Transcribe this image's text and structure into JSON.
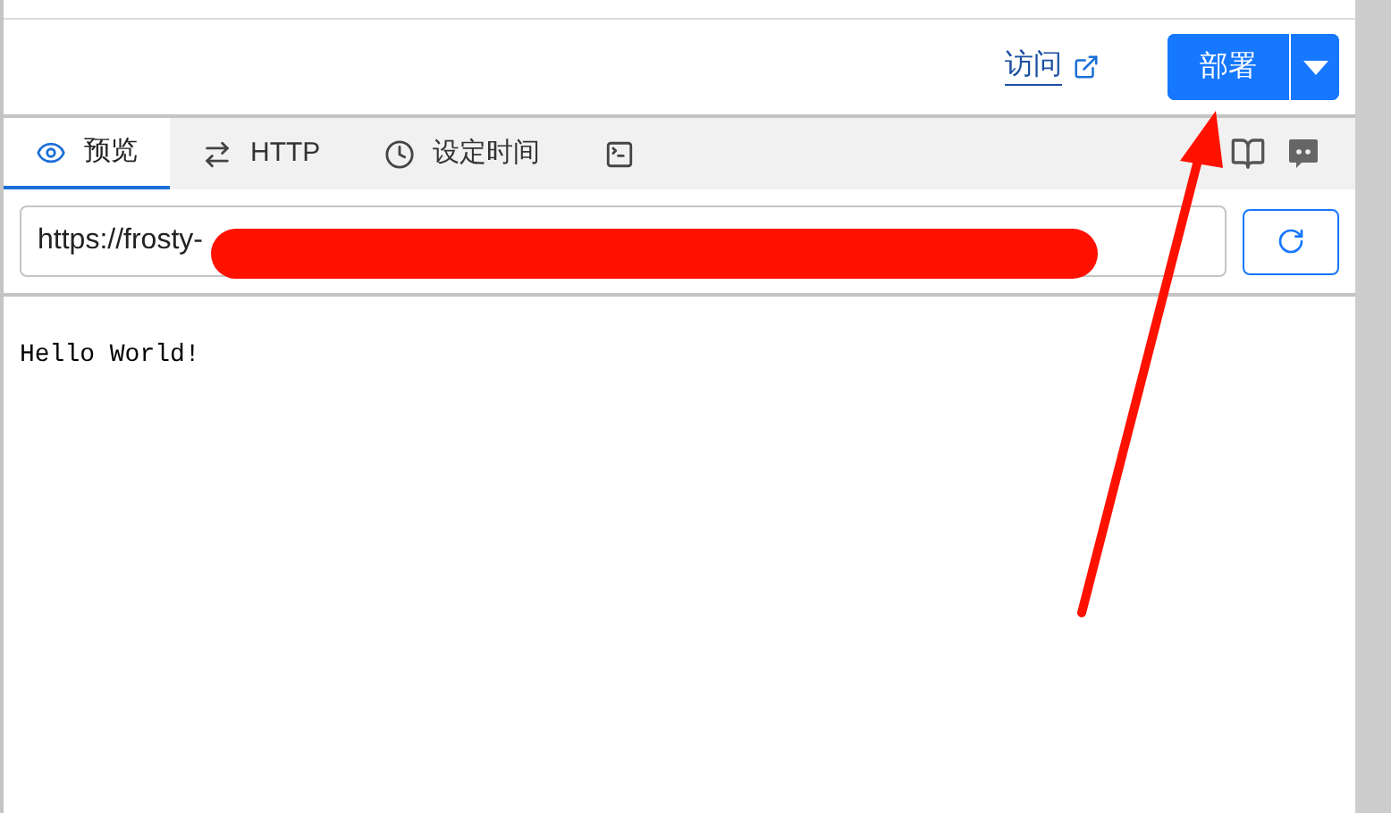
{
  "header": {
    "visit_link": "访问",
    "deploy_button": "部署"
  },
  "tabs": [
    {
      "label": "预览",
      "kind": "eye",
      "selected": true
    },
    {
      "label": "HTTP",
      "kind": "arrows",
      "selected": false
    },
    {
      "label": "设定时间",
      "kind": "clock",
      "selected": false
    },
    {
      "kind": "terminal",
      "selected": false
    }
  ],
  "url_field": {
    "value": "https://frosty-"
  },
  "preview": {
    "text": "Hello World!"
  }
}
